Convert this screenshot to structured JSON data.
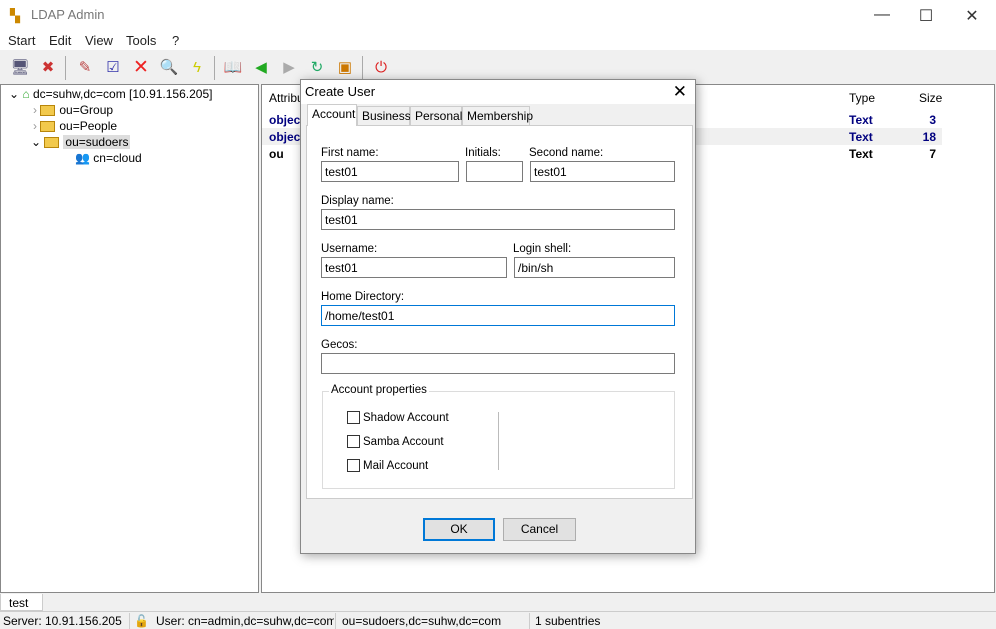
{
  "app": {
    "title": "LDAP Admin"
  },
  "menu": [
    {
      "label": "Start"
    },
    {
      "label": "Edit"
    },
    {
      "label": "View"
    },
    {
      "label": "Tools"
    },
    {
      "label": "?"
    }
  ],
  "toolbar": [
    "connect-icon",
    "disconnect-icon",
    "edit-icon",
    "properties-icon",
    "delete-icon",
    "search-icon",
    "lightning-icon",
    "book-icon",
    "back-icon",
    "forward-icon",
    "refresh-icon",
    "schema-icon",
    "exit-icon"
  ],
  "tree": {
    "root": "dc=suhw,dc=com [10.91.156.205]",
    "items": [
      {
        "label": "ou=Group"
      },
      {
        "label": "ou=People"
      },
      {
        "label": "ou=sudoers"
      }
    ],
    "child": "cn=cloud"
  },
  "attributes": {
    "headers": {
      "attribute": "Attribute",
      "type": "Type",
      "size": "Size"
    },
    "rows": [
      {
        "name": "objectClass",
        "type": "Text",
        "size": "3"
      },
      {
        "name": "objectClass",
        "type": "Text",
        "size": "18"
      },
      {
        "name": "ou",
        "type": "Text",
        "size": "7"
      }
    ]
  },
  "bottom_tab": "test",
  "status": {
    "server": "Server: 10.91.156.205",
    "user": "User: cn=admin,dc=suhw,dc=com",
    "dn": "ou=sudoers,dc=suhw,dc=com",
    "count": "1 subentries"
  },
  "dialog": {
    "title": "Create User",
    "tabs": [
      {
        "label": "Account"
      },
      {
        "label": "Business"
      },
      {
        "label": "Personal"
      },
      {
        "label": "Membership"
      }
    ],
    "fields": {
      "first_name": {
        "label": "First name:",
        "value": "test01"
      },
      "initials": {
        "label": "Initials:",
        "value": ""
      },
      "second_name": {
        "label": "Second name:",
        "value": "test01"
      },
      "display_name": {
        "label": "Display name:",
        "value": "test01"
      },
      "username": {
        "label": "Username:",
        "value": "test01"
      },
      "login_shell": {
        "label": "Login shell:",
        "value": "/bin/sh"
      },
      "home_directory": {
        "label": "Home Directory:",
        "value": "/home/test01"
      },
      "gecos": {
        "label": "Gecos:",
        "value": ""
      }
    },
    "account_properties": {
      "caption": "Account properties",
      "options": [
        {
          "label": "Shadow Account",
          "checked": false
        },
        {
          "label": "Samba Account",
          "checked": false
        },
        {
          "label": "Mail Account",
          "checked": false
        }
      ]
    },
    "ok": "OK",
    "cancel": "Cancel"
  }
}
